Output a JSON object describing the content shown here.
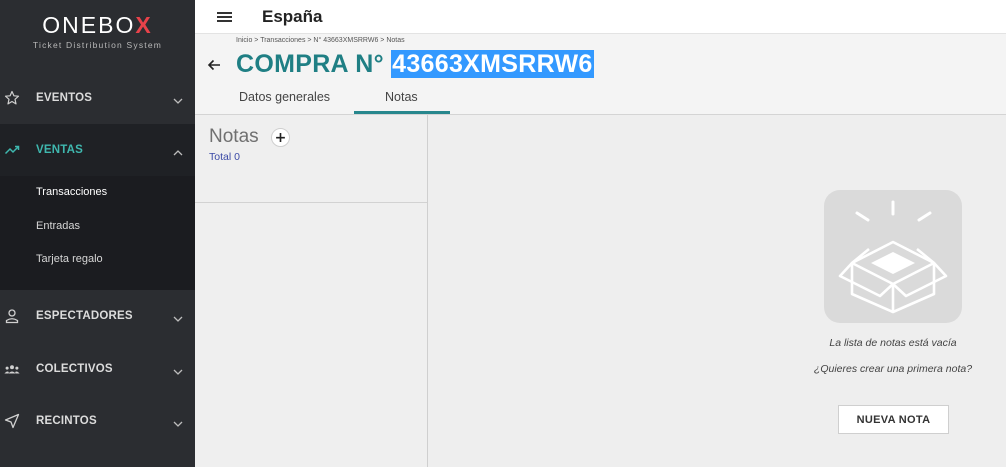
{
  "sidebar": {
    "logo": {
      "main": "ONEBO",
      "accent": "X",
      "subtitle": "Ticket Distribution System"
    },
    "items": [
      {
        "label": "EVENTOS",
        "icon": "star-icon"
      },
      {
        "label": "VENTAS",
        "icon": "trending-up-icon",
        "active": true
      },
      {
        "label": "ESPECTADORES",
        "icon": "person-icon"
      },
      {
        "label": "COLECTIVOS",
        "icon": "group-icon"
      },
      {
        "label": "RECINTOS",
        "icon": "navigation-icon"
      }
    ],
    "submenu": [
      {
        "label": "Transacciones",
        "active": true
      },
      {
        "label": "Entradas"
      },
      {
        "label": "Tarjeta regalo"
      }
    ]
  },
  "topbar": {
    "title": "España"
  },
  "header": {
    "breadcrumb": "Inicio > Transacciones > N° 43663XMSRRW6 > Notas",
    "title_prefix": "COMPRA N° ",
    "title_id": "43663XMSRRW6",
    "tabs": [
      {
        "label": "Datos generales",
        "active": false
      },
      {
        "label": "Notas",
        "active": true
      }
    ]
  },
  "notes": {
    "title": "Notas",
    "add_label": "+",
    "total": "Total 0"
  },
  "empty_state": {
    "title": "La lista de notas está vacía",
    "subtitle": "¿Quieres crear una primera nota?",
    "button": "NUEVA NOTA"
  },
  "colors": {
    "sidebar_bg": "#2b2d31",
    "accent_teal": "#1f7f84",
    "active_menu": "#3fb8af",
    "selection_blue": "#3399ff",
    "logo_red": "#e8424a"
  }
}
